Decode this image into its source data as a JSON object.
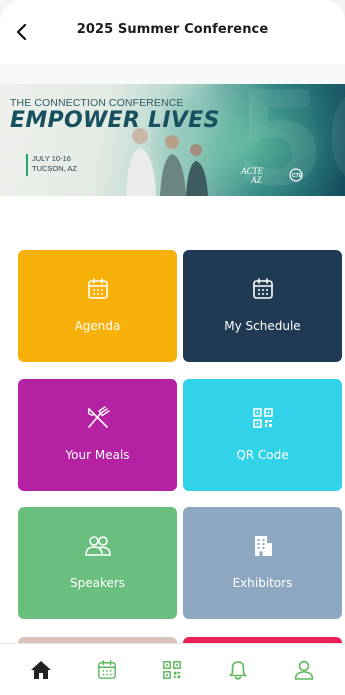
{
  "header": {
    "title": "2025 Summer Conference",
    "back_icon": "chevron-left-icon"
  },
  "banner": {
    "line1": "THE CONNECTION CONFERENCE",
    "line2": "EMPOWER LIVES",
    "date_line1": "JULY 10-16",
    "date_line2": "TUCSON, AZ",
    "logo1_line1": "ACTE",
    "logo1_line2": "AZ",
    "logo2_text": "CTE"
  },
  "tiles": [
    {
      "label": "Agenda",
      "icon": "calendar-icon",
      "color": "#f8b10a"
    },
    {
      "label": "My Schedule",
      "icon": "calendar-icon",
      "color": "#203a54"
    },
    {
      "label": "Your Meals",
      "icon": "fork-knife-icon",
      "color": "#b521a3"
    },
    {
      "label": "QR Code",
      "icon": "qr-code-icon",
      "color": "#30d3e8"
    },
    {
      "label": "Speakers",
      "icon": "people-icon",
      "color": "#6bbf7e"
    },
    {
      "label": "Exhibitors",
      "icon": "building-icon",
      "color": "#8fa8c1"
    }
  ],
  "tabbar": {
    "items": [
      {
        "icon": "home-icon",
        "active": true
      },
      {
        "icon": "calendar-icon",
        "active": false
      },
      {
        "icon": "qr-code-icon",
        "active": false
      },
      {
        "icon": "bell-icon",
        "active": false
      },
      {
        "icon": "user-icon",
        "active": false
      }
    ],
    "active_color": "#222222",
    "inactive_color": "#5cb85c"
  }
}
